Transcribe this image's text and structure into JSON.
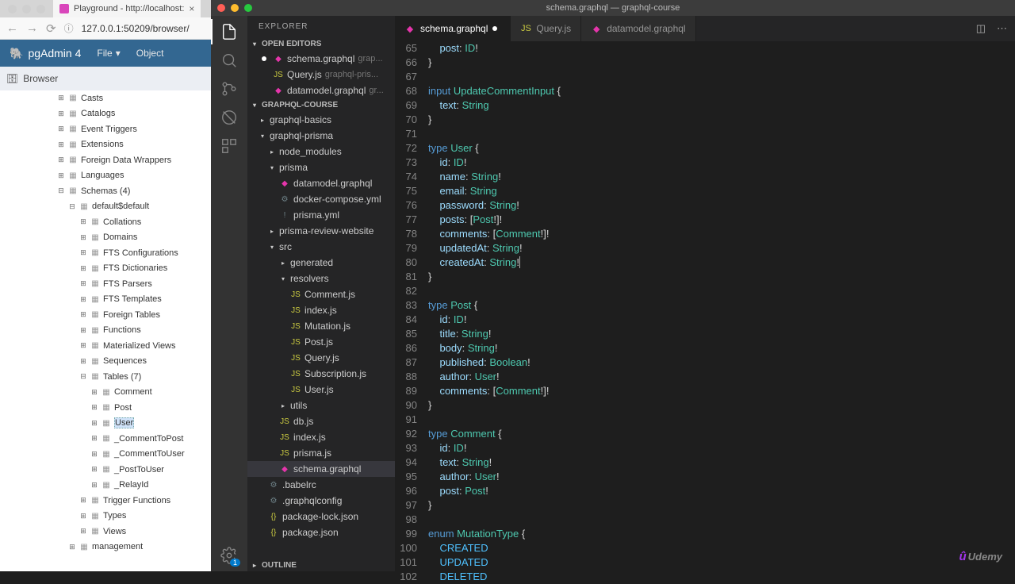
{
  "browser": {
    "tab_title": "Playground - http://localhost:",
    "url": "127.0.0.1:50209/browser/",
    "pg_title": "pgAdmin 4",
    "file_menu": "File",
    "object_menu": "Object",
    "browser_label": "Browser",
    "tree": [
      {
        "indent": 72,
        "icon": "⊞",
        "label": "Casts"
      },
      {
        "indent": 72,
        "icon": "⊞",
        "label": "Catalogs"
      },
      {
        "indent": 72,
        "icon": "⊞",
        "label": "Event Triggers"
      },
      {
        "indent": 72,
        "icon": "⊞",
        "label": "Extensions"
      },
      {
        "indent": 72,
        "icon": "⊞",
        "label": "Foreign Data Wrappers"
      },
      {
        "indent": 72,
        "icon": "⊞",
        "label": "Languages"
      },
      {
        "indent": 72,
        "icon": "⊟",
        "label": "Schemas (4)"
      },
      {
        "indent": 86,
        "icon": "⊟",
        "label": "default$default"
      },
      {
        "indent": 100,
        "icon": "⊞",
        "label": "Collations"
      },
      {
        "indent": 100,
        "icon": "⊞",
        "label": "Domains"
      },
      {
        "indent": 100,
        "icon": "⊞",
        "label": "FTS Configurations"
      },
      {
        "indent": 100,
        "icon": "⊞",
        "label": "FTS Dictionaries"
      },
      {
        "indent": 100,
        "icon": "⊞",
        "label": "FTS Parsers"
      },
      {
        "indent": 100,
        "icon": "⊞",
        "label": "FTS Templates"
      },
      {
        "indent": 100,
        "icon": "⊞",
        "label": "Foreign Tables"
      },
      {
        "indent": 100,
        "icon": "⊞",
        "label": "Functions"
      },
      {
        "indent": 100,
        "icon": "⊞",
        "label": "Materialized Views"
      },
      {
        "indent": 100,
        "icon": "⊞",
        "label": "Sequences"
      },
      {
        "indent": 100,
        "icon": "⊟",
        "label": "Tables (7)"
      },
      {
        "indent": 114,
        "icon": "⊞",
        "label": "Comment"
      },
      {
        "indent": 114,
        "icon": "⊞",
        "label": "Post"
      },
      {
        "indent": 114,
        "icon": "⊞",
        "label": "User",
        "sel": true
      },
      {
        "indent": 114,
        "icon": "⊞",
        "label": "_CommentToPost"
      },
      {
        "indent": 114,
        "icon": "⊞",
        "label": "_CommentToUser"
      },
      {
        "indent": 114,
        "icon": "⊞",
        "label": "_PostToUser"
      },
      {
        "indent": 114,
        "icon": "⊞",
        "label": "_RelayId"
      },
      {
        "indent": 100,
        "icon": "⊞",
        "label": "Trigger Functions"
      },
      {
        "indent": 100,
        "icon": "⊞",
        "label": "Types"
      },
      {
        "indent": 100,
        "icon": "⊞",
        "label": "Views"
      },
      {
        "indent": 86,
        "icon": "⊞",
        "label": "management"
      }
    ]
  },
  "vsc": {
    "title": "schema.graphql — graphql-course",
    "explorer_title": "EXPLORER",
    "open_editors": "OPEN EDITORS",
    "open_list": [
      {
        "ico": "◆",
        "cls": "ico-gql",
        "name": "schema.graphql",
        "hint": "grap...",
        "mod": true
      },
      {
        "ico": "JS",
        "cls": "ico-js",
        "name": "Query.js",
        "hint": "graphql-pris..."
      },
      {
        "ico": "◆",
        "cls": "ico-gql",
        "name": "datamodel.graphql",
        "hint": "gr..."
      }
    ],
    "proj_name": "GRAPHQL-COURSE",
    "tree": [
      {
        "indent": 14,
        "chev": "▸",
        "label": "graphql-basics"
      },
      {
        "indent": 14,
        "chev": "▾",
        "label": "graphql-prisma"
      },
      {
        "indent": 26,
        "chev": "▸",
        "label": "node_modules"
      },
      {
        "indent": 26,
        "chev": "▾",
        "label": "prisma"
      },
      {
        "indent": 40,
        "ico": "◆",
        "cls": "ico-gql",
        "label": "datamodel.graphql"
      },
      {
        "indent": 40,
        "ico": "⚙",
        "cls": "ico-yml",
        "label": "docker-compose.yml"
      },
      {
        "indent": 40,
        "ico": "!",
        "cls": "ico-yml",
        "label": "prisma.yml"
      },
      {
        "indent": 26,
        "chev": "▸",
        "label": "prisma-review-website"
      },
      {
        "indent": 26,
        "chev": "▾",
        "label": "src"
      },
      {
        "indent": 40,
        "chev": "▸",
        "label": "generated"
      },
      {
        "indent": 40,
        "chev": "▾",
        "label": "resolvers"
      },
      {
        "indent": 54,
        "ico": "JS",
        "cls": "ico-js",
        "label": "Comment.js"
      },
      {
        "indent": 54,
        "ico": "JS",
        "cls": "ico-js",
        "label": "index.js"
      },
      {
        "indent": 54,
        "ico": "JS",
        "cls": "ico-js",
        "label": "Mutation.js"
      },
      {
        "indent": 54,
        "ico": "JS",
        "cls": "ico-js",
        "label": "Post.js"
      },
      {
        "indent": 54,
        "ico": "JS",
        "cls": "ico-js",
        "label": "Query.js"
      },
      {
        "indent": 54,
        "ico": "JS",
        "cls": "ico-js",
        "label": "Subscription.js"
      },
      {
        "indent": 54,
        "ico": "JS",
        "cls": "ico-js",
        "label": "User.js"
      },
      {
        "indent": 40,
        "chev": "▸",
        "label": "utils"
      },
      {
        "indent": 40,
        "ico": "JS",
        "cls": "ico-js",
        "label": "db.js"
      },
      {
        "indent": 40,
        "ico": "JS",
        "cls": "ico-js",
        "label": "index.js"
      },
      {
        "indent": 40,
        "ico": "JS",
        "cls": "ico-js",
        "label": "prisma.js"
      },
      {
        "indent": 40,
        "ico": "◆",
        "cls": "ico-gql",
        "label": "schema.graphql",
        "sel": true
      },
      {
        "indent": 26,
        "ico": "⚙",
        "cls": "ico-yml",
        "label": ".babelrc"
      },
      {
        "indent": 26,
        "ico": "⚙",
        "cls": "ico-yml",
        "label": ".graphqlconfig"
      },
      {
        "indent": 26,
        "ico": "{}",
        "cls": "ico-json",
        "label": "package-lock.json"
      },
      {
        "indent": 26,
        "ico": "{}",
        "cls": "ico-json",
        "label": "package.json"
      }
    ],
    "outline": "OUTLINE",
    "tabs": [
      {
        "ico": "◆",
        "cls": "ico-gql",
        "label": "schema.graphql",
        "active": true,
        "mod": true
      },
      {
        "ico": "JS",
        "cls": "ico-js",
        "label": "Query.js"
      },
      {
        "ico": "◆",
        "cls": "ico-gql",
        "label": "datamodel.graphql"
      }
    ],
    "code_lines": [
      {
        "n": 65,
        "h": "    <span class='fld'>post</span><span class='pn'>: </span><span class='sc'>ID</span><span class='pn'>!</span>"
      },
      {
        "n": 66,
        "h": "<span class='pn'>}</span>"
      },
      {
        "n": 67,
        "h": ""
      },
      {
        "n": 68,
        "h": "<span class='kw'>input</span> <span class='ty'>UpdateCommentInput</span> <span class='pn'>{</span>"
      },
      {
        "n": 69,
        "h": "    <span class='fld'>text</span><span class='pn'>: </span><span class='sc'>String</span>"
      },
      {
        "n": 70,
        "h": "<span class='pn'>}</span>"
      },
      {
        "n": 71,
        "h": ""
      },
      {
        "n": 72,
        "h": "<span class='kw'>type</span> <span class='ty'>User</span> <span class='pn'>{</span>"
      },
      {
        "n": 73,
        "h": "    <span class='fld'>id</span><span class='pn'>: </span><span class='sc'>ID</span><span class='pn'>!</span>"
      },
      {
        "n": 74,
        "h": "    <span class='fld'>name</span><span class='pn'>: </span><span class='sc'>String</span><span class='pn'>!</span>"
      },
      {
        "n": 75,
        "h": "    <span class='fld'>email</span><span class='pn'>: </span><span class='sc'>String</span>"
      },
      {
        "n": 76,
        "h": "    <span class='fld'>password</span><span class='pn'>: </span><span class='sc'>String</span><span class='pn'>!</span>"
      },
      {
        "n": 77,
        "h": "    <span class='fld'>posts</span><span class='pn'>: [</span><span class='ty'>Post</span><span class='pn'>!]!</span>"
      },
      {
        "n": 78,
        "h": "    <span class='fld'>comments</span><span class='pn'>: [</span><span class='ty'>Comment</span><span class='pn'>!]!</span>"
      },
      {
        "n": 79,
        "h": "    <span class='fld'>updatedAt</span><span class='pn'>: </span><span class='sc'>String</span><span class='pn'>!</span>"
      },
      {
        "n": 80,
        "h": "    <span class='fld'>createdAt</span><span class='pn'>: </span><span class='sc'>String</span><span class='pn'>!</span><span class='cursor'></span>"
      },
      {
        "n": 81,
        "h": "<span class='pn'>}</span>"
      },
      {
        "n": 82,
        "h": ""
      },
      {
        "n": 83,
        "h": "<span class='kw'>type</span> <span class='ty'>Post</span> <span class='pn'>{</span>"
      },
      {
        "n": 84,
        "h": "    <span class='fld'>id</span><span class='pn'>: </span><span class='sc'>ID</span><span class='pn'>!</span>"
      },
      {
        "n": 85,
        "h": "    <span class='fld'>title</span><span class='pn'>: </span><span class='sc'>String</span><span class='pn'>!</span>"
      },
      {
        "n": 86,
        "h": "    <span class='fld'>body</span><span class='pn'>: </span><span class='sc'>String</span><span class='pn'>!</span>"
      },
      {
        "n": 87,
        "h": "    <span class='fld'>published</span><span class='pn'>: </span><span class='sc'>Boolean</span><span class='pn'>!</span>"
      },
      {
        "n": 88,
        "h": "    <span class='fld'>author</span><span class='pn'>: </span><span class='ty'>User</span><span class='pn'>!</span>"
      },
      {
        "n": 89,
        "h": "    <span class='fld'>comments</span><span class='pn'>: [</span><span class='ty'>Comment</span><span class='pn'>!]!</span>"
      },
      {
        "n": 90,
        "h": "<span class='pn'>}</span>"
      },
      {
        "n": 91,
        "h": ""
      },
      {
        "n": 92,
        "h": "<span class='kw'>type</span> <span class='ty'>Comment</span> <span class='pn'>{</span>"
      },
      {
        "n": 93,
        "h": "    <span class='fld'>id</span><span class='pn'>: </span><span class='sc'>ID</span><span class='pn'>!</span>"
      },
      {
        "n": 94,
        "h": "    <span class='fld'>text</span><span class='pn'>: </span><span class='sc'>String</span><span class='pn'>!</span>"
      },
      {
        "n": 95,
        "h": "    <span class='fld'>author</span><span class='pn'>: </span><span class='ty'>User</span><span class='pn'>!</span>"
      },
      {
        "n": 96,
        "h": "    <span class='fld'>post</span><span class='pn'>: </span><span class='ty'>Post</span><span class='pn'>!</span>"
      },
      {
        "n": 97,
        "h": "<span class='pn'>}</span>"
      },
      {
        "n": 98,
        "h": ""
      },
      {
        "n": 99,
        "h": "<span class='kw'>enum</span> <span class='ty'>MutationType</span> <span class='pn'>{</span>"
      },
      {
        "n": 100,
        "h": "    <span class='en'>CREATED</span>"
      },
      {
        "n": 101,
        "h": "    <span class='en'>UPDATED</span>"
      },
      {
        "n": 102,
        "h": "    <span class='en'>DELETED</span>"
      }
    ],
    "gear_badge": "1"
  },
  "watermark": "Udemy"
}
